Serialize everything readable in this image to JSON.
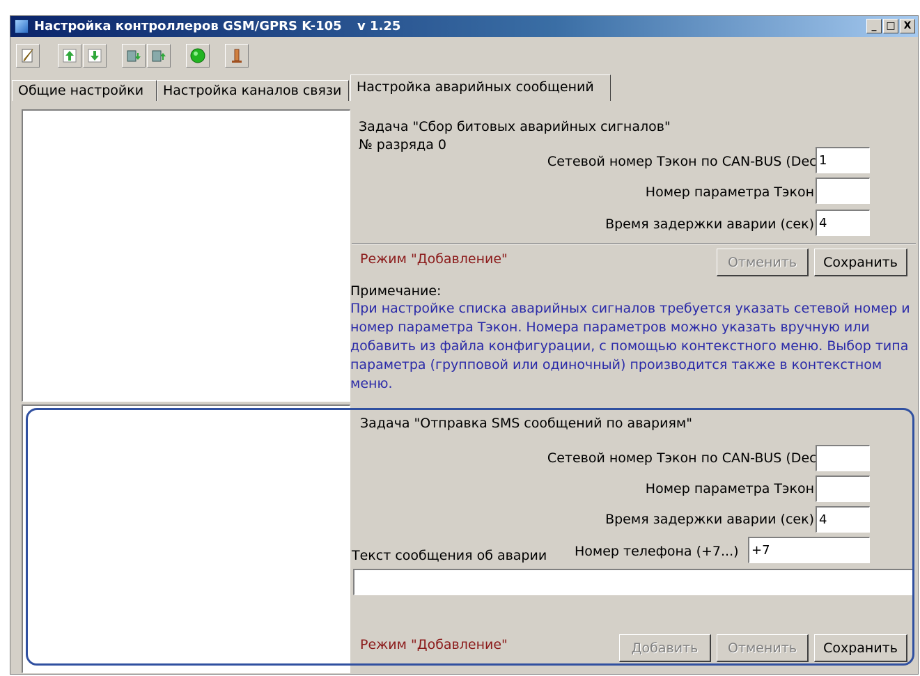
{
  "window": {
    "title": "Настройка контроллеров GSM/GPRS K-105",
    "version": "v 1.25",
    "controls": {
      "minimize": "_",
      "maximize": "□",
      "close": "X"
    }
  },
  "toolbar": {
    "buttons": [
      "edit-icon",
      "arrow-up-icon",
      "arrow-down-icon",
      "upload-icon",
      "download-icon",
      "connect-icon",
      "disconnect-icon"
    ]
  },
  "tabs": [
    {
      "label": "Общие настройки"
    },
    {
      "label": "Настройка каналов связи"
    },
    {
      "label": "Настройка аварийных сообщений"
    }
  ],
  "bit_alarm": {
    "task_title": "Задача \"Сбор битовых аварийных сигналов\"",
    "bit_number": "№ разряда 0",
    "can_label": "Сетевой номер Тэкон по CAN-BUS  (Dec)",
    "can_value": "1",
    "param_label": "Номер параметра Тэкон",
    "param_value": "",
    "delay_label": "Время задержки аварии (сек)",
    "delay_value": "4",
    "mode": "Режим \"Добавление\"",
    "cancel_label": "Отменить",
    "save_label": "Сохранить",
    "note_title": "Примечание:",
    "note_lines": [
      "При настройке списка аварийных сигналов требуется указать сетевой номер и",
      "номер параметра Тэкон. Номера параметров можно указать вручную или",
      "добавить из файла конфигурации, с помощью контекстного меню. Выбор типа",
      "параметра (групповой или одиночный) производится также в контекстном",
      "меню."
    ]
  },
  "sms_alarm": {
    "task_title": "Задача \"Отправка SMS сообщений по авариям\"",
    "can_label": "Сетевой номер Тэкон по CAN-BUS  (Dec)",
    "can_value": "",
    "param_label": "Номер параметра Тэкон",
    "param_value": "",
    "delay_label": "Время задержки аварии (сек)",
    "delay_value": "4",
    "message_label": "Текст сообщения об аварии",
    "phone_label": "Номер телефона (+7...)",
    "phone_value": "+7",
    "message_value": "",
    "mode": "Режим \"Добавление\"",
    "add_label": "Добавить",
    "cancel_label": "Отменить",
    "save_label": "Сохранить"
  },
  "colors": {
    "accent_highlight": "#3050a0",
    "mode_text": "#8b1a1a",
    "note_text": "#2a2aa8"
  }
}
